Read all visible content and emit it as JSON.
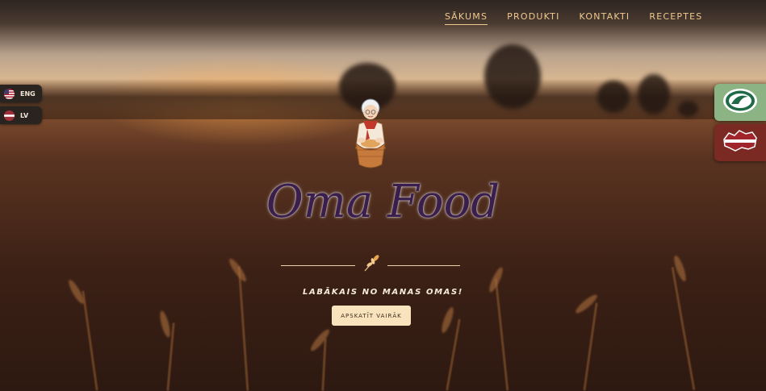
{
  "nav": {
    "items": [
      {
        "label": "SĀKUMS",
        "active": true
      },
      {
        "label": "PRODUKTI",
        "active": false
      },
      {
        "label": "KONTAKTI",
        "active": false
      },
      {
        "label": "RECEPTES",
        "active": false
      }
    ]
  },
  "languages": [
    {
      "code": "ENG",
      "flag": "us-flag-icon"
    },
    {
      "code": "LV",
      "flag": "latvia-flag-icon"
    }
  ],
  "side_badges": [
    {
      "icon": "green-seal-icon",
      "color": "#8bb384"
    },
    {
      "icon": "latvia-map-icon",
      "color": "#7a2a23"
    }
  ],
  "hero": {
    "brand": "Oma Food",
    "tagline": "LABĀKAIS NO MANAS OMAS!",
    "cta_label": "APSKATĪT VAIRĀK",
    "mascot_icon": "grandma-with-bread-basket-icon",
    "divider_icon": "wheat-icon"
  },
  "colors": {
    "nav_text": "#f0c98f",
    "logo_text": "#3a1f4e",
    "cta_background": "#f8e3bd"
  }
}
